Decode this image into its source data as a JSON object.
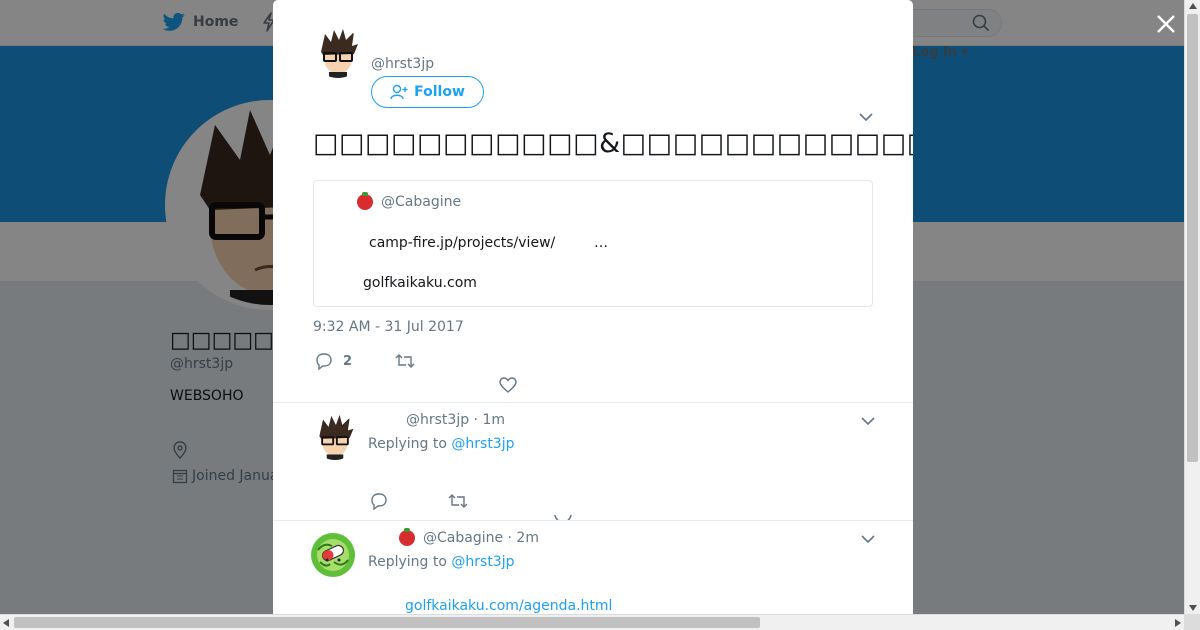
{
  "nav": {
    "home_label": "Home",
    "login_label": "Log in",
    "icons": [
      "twitter-bird-icon",
      "lightning-icon",
      "search-icon",
      "caret-down-icon"
    ]
  },
  "profile": {
    "name": "□□□□□□□□□",
    "handle": "@hrst3jp",
    "bio": "WEBSOHO",
    "joined": "Joined Janua"
  },
  "tweet": {
    "handle": "@hrst3jp",
    "follow_label": "Follow",
    "text": "□□□□□□□□□□□&□□□□□□□□□□□□□□□□□□□□□□□□□□□□□□□□□□□□□□□□□□□□□□□□",
    "quote_handle": "@Cabagine",
    "card_link": "camp-fire.jp/projects/view/",
    "card_ellipsis": "…",
    "card_domain": "golfkaikaku.com",
    "timestamp": "9:32 AM - 31 Jul 2017",
    "reply_count": "2"
  },
  "replies": [
    {
      "meta": "@hrst3jp · 1m",
      "replying_prefix": "Replying to ",
      "replying_to": "@hrst3jp"
    },
    {
      "meta": "@Cabagine · 2m",
      "replying_prefix": "Replying to ",
      "replying_to": "@hrst3jp",
      "link": "golfkaikaku.com/agenda.html"
    }
  ],
  "colors": {
    "accent": "#1da1f2",
    "cover": "#1b95e0",
    "tomato": "#d72d2d"
  }
}
